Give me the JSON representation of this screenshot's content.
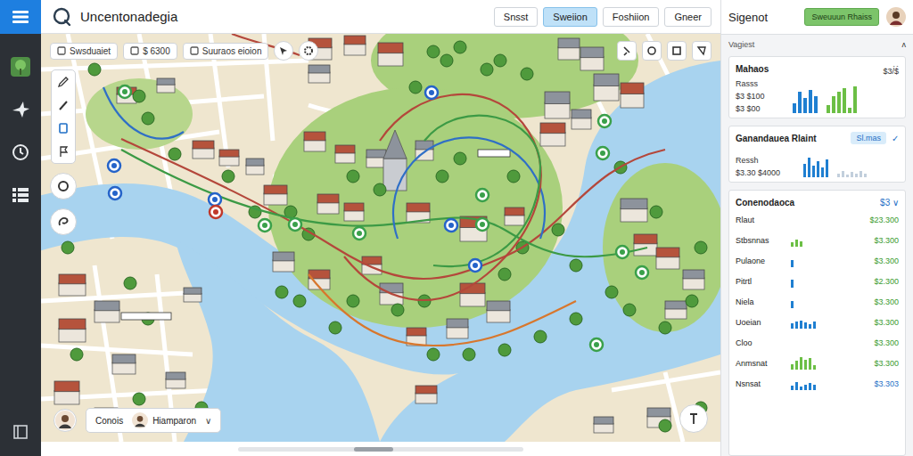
{
  "app": {
    "title": "Uncentonadegia"
  },
  "tabs": [
    {
      "label": "Snsst",
      "selected": false
    },
    {
      "label": "Sweiion",
      "selected": true
    },
    {
      "label": "Foshiion",
      "selected": false
    },
    {
      "label": "Gneer",
      "selected": false
    }
  ],
  "map": {
    "toolbar_chips": [
      {
        "label": "Swsduaiet"
      },
      {
        "label": "$ 6300"
      },
      {
        "label": "Suuraos eioion"
      }
    ],
    "routes": [
      {
        "color": "#b4473b"
      },
      {
        "color": "#3c9a45"
      },
      {
        "color": "#2f6fc6"
      },
      {
        "color": "#d8772d"
      },
      {
        "color": "#b4473b"
      },
      {
        "color": "#3c9a45"
      }
    ],
    "pins": [
      {
        "color": "#3aa04a"
      },
      {
        "color": "#2563c9"
      },
      {
        "color": "#2563c9"
      },
      {
        "color": "#2563c9"
      },
      {
        "color": "#2563c9"
      },
      {
        "color": "#c0392b"
      },
      {
        "color": "#3aa04a"
      },
      {
        "color": "#3aa04a"
      },
      {
        "color": "#3aa04a"
      },
      {
        "color": "#2563c9"
      },
      {
        "color": "#3aa04a"
      },
      {
        "color": "#2563c9"
      },
      {
        "color": "#3aa04a"
      },
      {
        "color": "#3aa04a"
      },
      {
        "color": "#3aa04a"
      },
      {
        "color": "#3aa04a"
      },
      {
        "color": "#3aa04a"
      },
      {
        "color": "#3aa04a"
      }
    ],
    "users": [
      {
        "name": "Conois"
      },
      {
        "name": "Hiamparon"
      }
    ],
    "user_menu_caret": "∨"
  },
  "panel": {
    "title": "Sigenot",
    "action_button": "Sweuuun Rhaiss",
    "section_label": "Vagiest",
    "section_caret": "ʌ",
    "summary_card": {
      "title": "Mahaos",
      "close": "×",
      "labels": [
        "Rasss",
        "$3 $100",
        "$3 $00"
      ],
      "tick": "$3/$",
      "series": [
        {
          "color": "#1f7fd1",
          "values": [
            10,
            22,
            16,
            24,
            18
          ]
        },
        {
          "color": "#6cbf45",
          "values": [
            8,
            18,
            22,
            26,
            6,
            28
          ]
        }
      ]
    },
    "report_card": {
      "title": "Ganandauea Rlaint",
      "badge": "Sl.mas",
      "check": "✓",
      "labels": [
        "Ressh",
        "$3.30 $4000"
      ],
      "series": [
        {
          "color": "#1f7fd1",
          "values": [
            14,
            20,
            12,
            16,
            10,
            18
          ]
        },
        {
          "color": "#c2cfdc",
          "values": [
            4,
            6,
            3,
            5,
            4,
            6,
            4
          ]
        }
      ]
    },
    "list_card": {
      "title": "Conenodaoca",
      "value": "$3",
      "caret": "∨",
      "rows": [
        {
          "name": "Rlaut",
          "color": "#6cbf45",
          "values": [],
          "value": "$23.300",
          "value_color": "#3a9a2e"
        },
        {
          "name": "Stbsnnas",
          "color": "#6cbf45",
          "values": [
            8,
            12,
            10
          ],
          "value": "$3.300",
          "value_color": "#3a9a2e"
        },
        {
          "name": "Pulaone",
          "color": "#1f7fd1",
          "values": [
            12
          ],
          "value": "$3.300",
          "value_color": "#3a9a2e"
        },
        {
          "name": "Pitrtl",
          "color": "#1f7fd1",
          "values": [
            14
          ],
          "value": "$2.300",
          "value_color": "#3a9a2e"
        },
        {
          "name": "Niela",
          "color": "#1f7fd1",
          "values": [
            12
          ],
          "value": "$3.300",
          "value_color": "#3a9a2e"
        },
        {
          "name": "Uoeian",
          "color": "#1f7fd1",
          "values": [
            10,
            12,
            14,
            11,
            8,
            13
          ],
          "value": "$3.300",
          "value_color": "#3a9a2e"
        },
        {
          "name": "Cloo",
          "color": "#1f7fd1",
          "values": [],
          "value": "$3.300",
          "value_color": "#3a9a2e"
        },
        {
          "name": "Anmsnat",
          "color": "#6cbf45",
          "values": [
            10,
            16,
            22,
            18,
            20,
            8
          ],
          "value": "$3.300",
          "value_color": "#3a9a2e"
        },
        {
          "name": "Nsnsat",
          "color": "#1f7fd1",
          "values": [
            8,
            14,
            6,
            10,
            12,
            9
          ],
          "value": "$3.303",
          "value_color": "#1f6fc6"
        }
      ]
    }
  }
}
